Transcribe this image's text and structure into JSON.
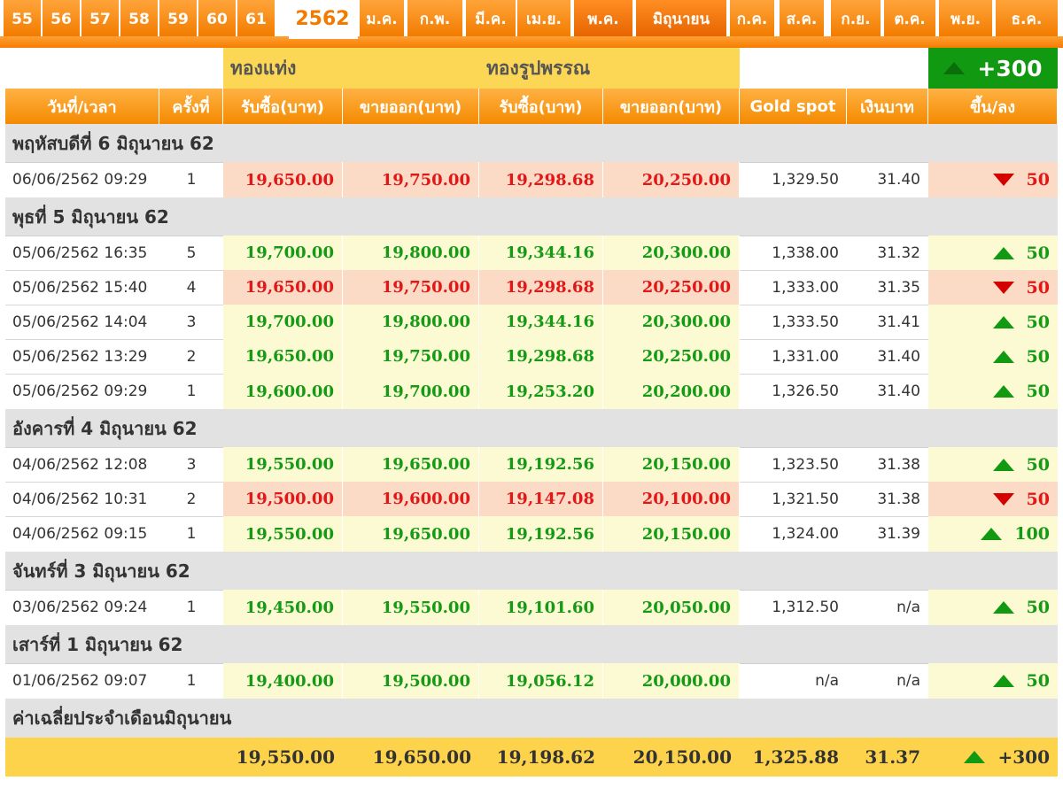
{
  "tabs": [
    {
      "label": "55",
      "type": "year"
    },
    {
      "label": "56",
      "type": "year"
    },
    {
      "label": "57",
      "type": "year"
    },
    {
      "label": "58",
      "type": "year"
    },
    {
      "label": "59",
      "type": "year"
    },
    {
      "label": "60",
      "type": "year"
    },
    {
      "label": "61",
      "type": "year"
    },
    {
      "label": "2562",
      "type": "year-active"
    },
    {
      "label": "ม.ค.",
      "type": "month"
    },
    {
      "label": "ก.พ.",
      "type": "month"
    },
    {
      "label": "มี.ค.",
      "type": "month"
    },
    {
      "label": "เม.ย.",
      "type": "month"
    },
    {
      "label": "พ.ค.",
      "type": "month-current"
    },
    {
      "label": "มิถุนายน",
      "type": "month-current"
    },
    {
      "label": "ก.ค.",
      "type": "month"
    },
    {
      "label": "ส.ค.",
      "type": "month"
    },
    {
      "label": "ก.ย.",
      "type": "month"
    },
    {
      "label": "ต.ค.",
      "type": "month"
    },
    {
      "label": "พ.ย.",
      "type": "month"
    },
    {
      "label": "ธ.ค.",
      "type": "month"
    }
  ],
  "groups": {
    "bar": "ทองแท่ง",
    "ornament": "ทองรูปพรรณ",
    "total_change": "+300",
    "total_direction": "up"
  },
  "headers": [
    "วันที่/เวลา",
    "ครั้งที่",
    "รับซื้อ(บาท)",
    "ขายออก(บาท)",
    "รับซื้อ(บาท)",
    "ขายออก(บาท)",
    "Gold spot",
    "เงินบาท",
    "ขึ้น/ลง"
  ],
  "sections": [
    {
      "title": "พฤหัสบดีที่ 6 มิถุนายน 62",
      "rows": [
        {
          "datetime": "06/06/2562 09:29",
          "round": "1",
          "bar_buy": "19,650.00",
          "bar_sell": "19,750.00",
          "orn_buy": "19,298.68",
          "orn_sell": "20,250.00",
          "spot": "1,329.50",
          "thb": "31.40",
          "dir": "down",
          "change": "50"
        }
      ]
    },
    {
      "title": "พุธที่ 5 มิถุนายน 62",
      "rows": [
        {
          "datetime": "05/06/2562 16:35",
          "round": "5",
          "bar_buy": "19,700.00",
          "bar_sell": "19,800.00",
          "orn_buy": "19,344.16",
          "orn_sell": "20,300.00",
          "spot": "1,338.00",
          "thb": "31.32",
          "dir": "up",
          "change": "50"
        },
        {
          "datetime": "05/06/2562 15:40",
          "round": "4",
          "bar_buy": "19,650.00",
          "bar_sell": "19,750.00",
          "orn_buy": "19,298.68",
          "orn_sell": "20,250.00",
          "spot": "1,333.00",
          "thb": "31.35",
          "dir": "down",
          "change": "50"
        },
        {
          "datetime": "05/06/2562 14:04",
          "round": "3",
          "bar_buy": "19,700.00",
          "bar_sell": "19,800.00",
          "orn_buy": "19,344.16",
          "orn_sell": "20,300.00",
          "spot": "1,333.50",
          "thb": "31.41",
          "dir": "up",
          "change": "50"
        },
        {
          "datetime": "05/06/2562 13:29",
          "round": "2",
          "bar_buy": "19,650.00",
          "bar_sell": "19,750.00",
          "orn_buy": "19,298.68",
          "orn_sell": "20,250.00",
          "spot": "1,331.00",
          "thb": "31.40",
          "dir": "up",
          "change": "50"
        },
        {
          "datetime": "05/06/2562 09:29",
          "round": "1",
          "bar_buy": "19,600.00",
          "bar_sell": "19,700.00",
          "orn_buy": "19,253.20",
          "orn_sell": "20,200.00",
          "spot": "1,326.50",
          "thb": "31.40",
          "dir": "up",
          "change": "50"
        }
      ]
    },
    {
      "title": "อังคารที่ 4 มิถุนายน 62",
      "rows": [
        {
          "datetime": "04/06/2562 12:08",
          "round": "3",
          "bar_buy": "19,550.00",
          "bar_sell": "19,650.00",
          "orn_buy": "19,192.56",
          "orn_sell": "20,150.00",
          "spot": "1,323.50",
          "thb": "31.38",
          "dir": "up",
          "change": "50"
        },
        {
          "datetime": "04/06/2562 10:31",
          "round": "2",
          "bar_buy": "19,500.00",
          "bar_sell": "19,600.00",
          "orn_buy": "19,147.08",
          "orn_sell": "20,100.00",
          "spot": "1,321.50",
          "thb": "31.38",
          "dir": "down",
          "change": "50"
        },
        {
          "datetime": "04/06/2562 09:15",
          "round": "1",
          "bar_buy": "19,550.00",
          "bar_sell": "19,650.00",
          "orn_buy": "19,192.56",
          "orn_sell": "20,150.00",
          "spot": "1,324.00",
          "thb": "31.39",
          "dir": "up",
          "change": "100"
        }
      ]
    },
    {
      "title": "จันทร์ที่ 3 มิถุนายน 62",
      "rows": [
        {
          "datetime": "03/06/2562 09:24",
          "round": "1",
          "bar_buy": "19,450.00",
          "bar_sell": "19,550.00",
          "orn_buy": "19,101.60",
          "orn_sell": "20,050.00",
          "spot": "1,312.50",
          "thb": "n/a",
          "dir": "up",
          "change": "50"
        }
      ]
    },
    {
      "title": "เสาร์ที่ 1 มิถุนายน 62",
      "rows": [
        {
          "datetime": "01/06/2562 09:07",
          "round": "1",
          "bar_buy": "19,400.00",
          "bar_sell": "19,500.00",
          "orn_buy": "19,056.12",
          "orn_sell": "20,000.00",
          "spot": "n/a",
          "thb": "n/a",
          "dir": "up",
          "change": "50"
        }
      ]
    }
  ],
  "average": {
    "title": "ค่าเฉลี่ยประจำเดือนมิถุนายน",
    "bar_buy": "19,550.00",
    "bar_sell": "19,650.00",
    "orn_buy": "19,198.62",
    "orn_sell": "20,150.00",
    "spot": "1,325.88",
    "thb": "31.37",
    "dir": "up",
    "change": "+300"
  },
  "colors": {
    "up": "#159a15",
    "down": "#e21818",
    "header": "#f48a00",
    "group": "#fcd655"
  }
}
